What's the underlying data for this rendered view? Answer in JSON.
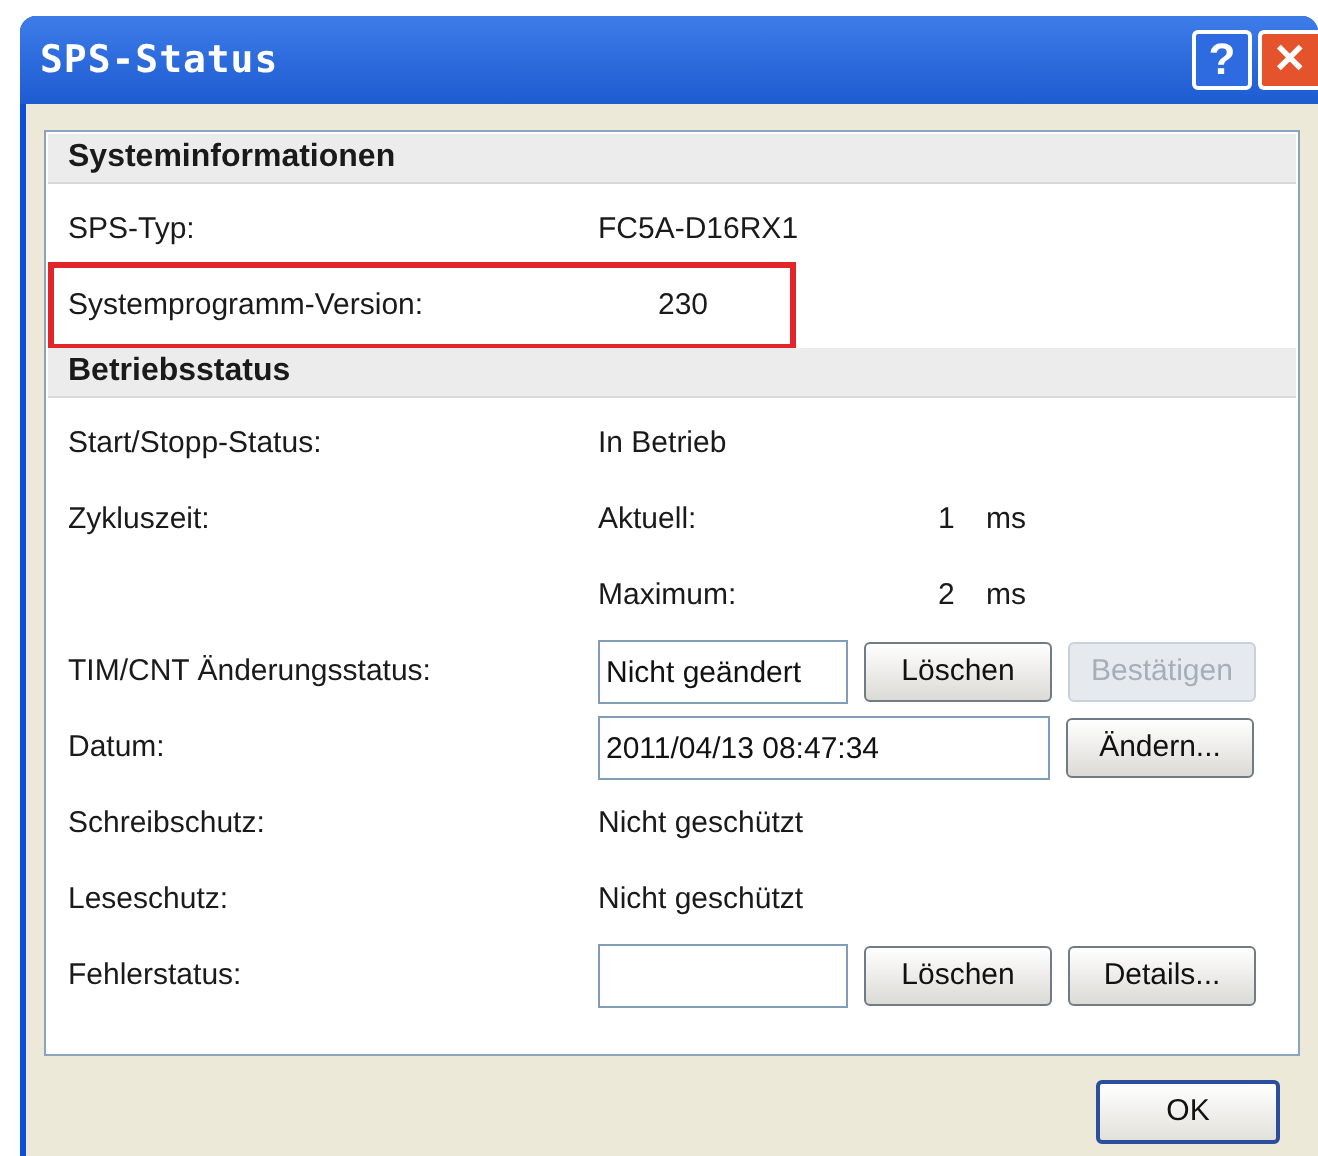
{
  "window": {
    "title": "SPS-Status",
    "help": "?",
    "close": "✕"
  },
  "sections": [
    {
      "title": "Systeminformationen",
      "rows": [
        {
          "kind": "text",
          "label": "SPS-Typ:",
          "value": "FC5A-D16RX1",
          "highlighted": false
        },
        {
          "kind": "text",
          "label": "Systemprogramm-Version:",
          "value": "230",
          "highlighted": true
        }
      ]
    },
    {
      "title": "Betriebsstatus",
      "rows": [
        {
          "kind": "text",
          "label": "Start/Stopp-Status:",
          "value": "In Betrieb",
          "highlighted": false
        },
        {
          "kind": "timing",
          "label": "Zykluszeit:",
          "name": "Aktuell:",
          "value": "1",
          "unit": "ms",
          "highlighted": false
        },
        {
          "kind": "timing",
          "label": "",
          "name": "Maximum:",
          "value": "2",
          "unit": "ms",
          "highlighted": false
        },
        {
          "kind": "field",
          "label": "TIM/CNT Änderungsstatus:",
          "value": "Nicht geändert",
          "wide": false,
          "buttons": [
            {
              "label": "Löschen",
              "disabled": false
            },
            {
              "label": "Bestätigen",
              "disabled": true
            }
          ],
          "highlighted": false
        },
        {
          "kind": "field",
          "label": "Datum:",
          "value": "2011/04/13 08:47:34",
          "wide": true,
          "buttons": [
            {
              "label": "Ändern...",
              "disabled": false
            }
          ],
          "highlighted": false
        },
        {
          "kind": "text",
          "label": "Schreibschutz:",
          "value": "Nicht geschützt",
          "highlighted": false
        },
        {
          "kind": "text",
          "label": "Leseschutz:",
          "value": "Nicht geschützt",
          "highlighted": false
        },
        {
          "kind": "field",
          "label": "Fehlerstatus:",
          "value": "",
          "wide": false,
          "buttons": [
            {
              "label": "Löschen",
              "disabled": false
            },
            {
              "label": "Details...",
              "disabled": false
            }
          ],
          "highlighted": false
        }
      ]
    }
  ],
  "ok_button": "OK"
}
